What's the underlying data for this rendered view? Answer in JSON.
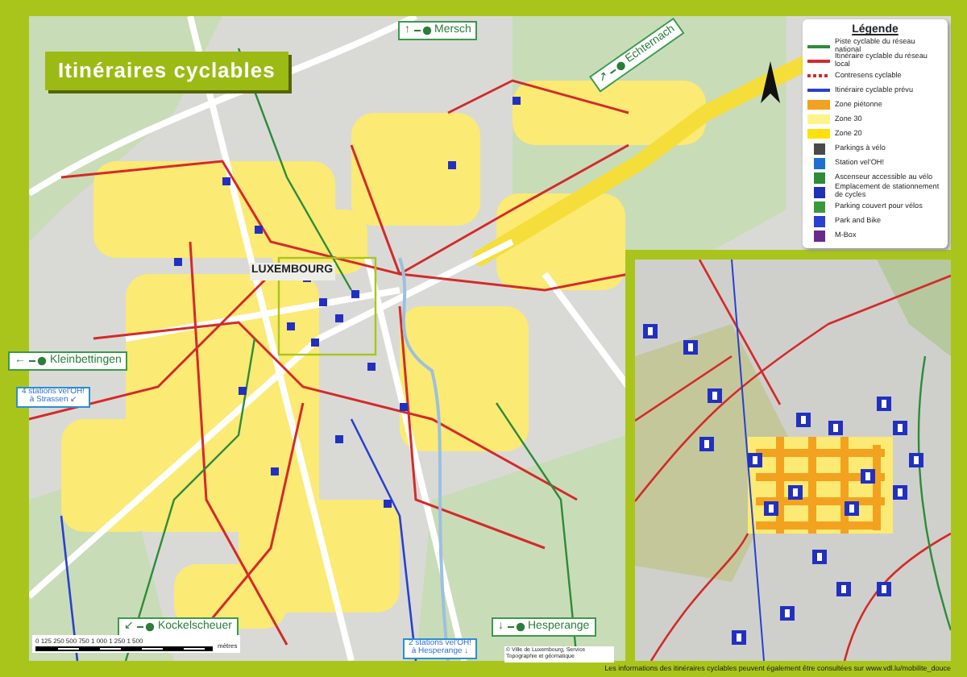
{
  "title": "Itinéraires cyclables",
  "map": {
    "city_label": "LUXEMBOURG",
    "signs": [
      {
        "kind": "direction",
        "arrow": "↑",
        "text": "Mersch"
      },
      {
        "kind": "direction",
        "arrow": "↗",
        "text": "Echternach"
      },
      {
        "kind": "direction",
        "arrow": "←",
        "text": "Kleinbettingen"
      },
      {
        "kind": "stations",
        "arrow": "↙",
        "text": "4 stations vel'OH! à Strassen"
      },
      {
        "kind": "direction",
        "arrow": "↙",
        "text": "Kockelscheuer"
      },
      {
        "kind": "stations",
        "arrow": "↓",
        "text": "2 stations vel'OH! à Hesperange"
      },
      {
        "kind": "direction",
        "arrow": "↓",
        "text": "Hesperange"
      }
    ],
    "scale": {
      "ticks": [
        "0",
        "125",
        "250",
        "500",
        "750",
        "1 000",
        "1 250",
        "1 500"
      ],
      "unit": "mètres"
    },
    "credit": "© Ville de Luxembourg, Service Topographie et géomatique"
  },
  "legend": {
    "title": "Légende",
    "items": [
      {
        "kind": "line",
        "color": "#2e8b3a",
        "label": "Piste cyclable du réseau national"
      },
      {
        "kind": "line",
        "color": "#d42a2a",
        "label": "Itinéraire cyclable du réseau local"
      },
      {
        "kind": "dashed",
        "color": "#d42a2a",
        "label": "Contresens cyclable"
      },
      {
        "kind": "line",
        "color": "#2b3fd0",
        "label": "Itinéraire cyclable prévu"
      },
      {
        "kind": "area",
        "color": "#f2a21e",
        "label": "Zone piétonne"
      },
      {
        "kind": "area",
        "color": "#fff38a",
        "label": "Zone 30"
      },
      {
        "kind": "area",
        "color": "#ffe10a",
        "label": "Zone 20"
      },
      {
        "kind": "icon",
        "color": "#4a4a4a",
        "label": "Parkings à vélo"
      },
      {
        "kind": "icon",
        "color": "#1d6fd1",
        "label": "Station vel'OH!"
      },
      {
        "kind": "icon",
        "color": "#2e8b3a",
        "label": "Ascenseur accessible au vélo"
      },
      {
        "kind": "icon",
        "color": "#1f2fb8",
        "label": "Emplacement de stationnement de cycles"
      },
      {
        "kind": "icon",
        "color": "#3a9a3a",
        "label": "Parking couvert pour vélos"
      },
      {
        "kind": "icon",
        "color": "#2b3fd0",
        "label": "Park and Bike"
      },
      {
        "kind": "icon",
        "color": "#6a2a8a",
        "label": "M-Box"
      }
    ]
  },
  "footer": "Les informations des itinéraires cyclables peuvent également être consultées sur www.vdl.lu/mobilite_douce"
}
